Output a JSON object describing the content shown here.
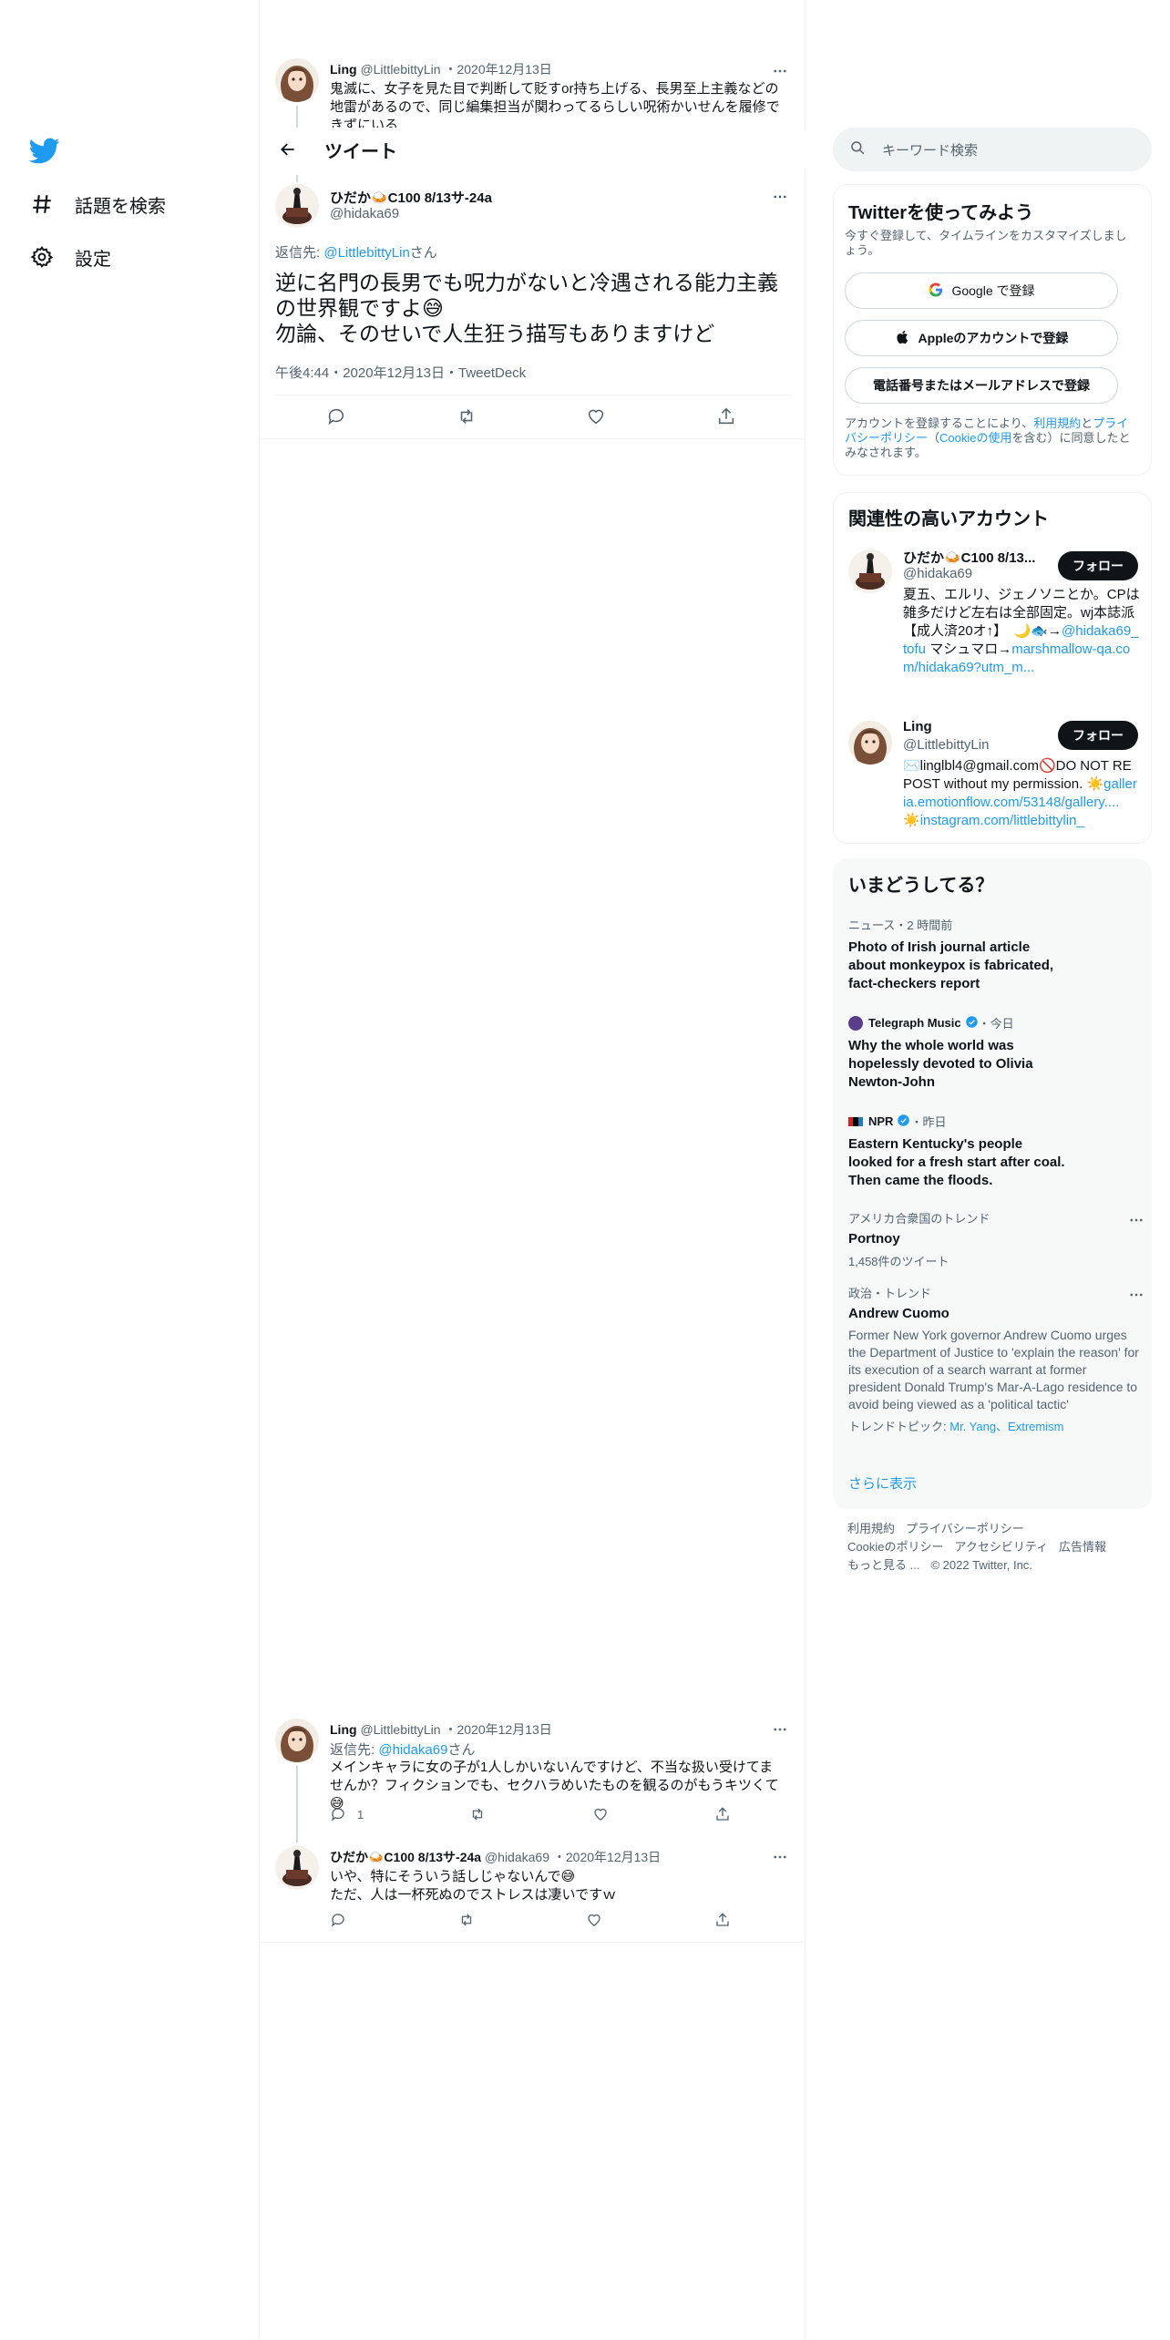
{
  "left_nav": {
    "explore_label": "話題を検索",
    "settings_label": "設定"
  },
  "header": {
    "title": "ツイート"
  },
  "parent_tweet": {
    "name": "Ling",
    "handle": "@LittlebittyLin",
    "date": "2020年12月13日",
    "text": "鬼滅に、女子を見た目で判断して貶すor持ち上げる、長男至上主義などの地雷があるので、同じ編集担当が関わってるらしい呪術かいせんを履修できずにいる"
  },
  "main_tweet": {
    "name": "ひだか🍛C100 8/13サ-24a",
    "handle": "@hidaka69",
    "reply_prefix": "返信先: ",
    "reply_to": "@LittlebittyLin",
    "reply_suffix": "さん",
    "line1": "逆に名門の長男でも呪力がないと冷遇される能力主義の世界観ですよ😅",
    "line2": "勿論、そのせいで人生狂う描写もありますけど",
    "time": "午後4:44",
    "date": "2020年12月13日",
    "source": "TweetDeck"
  },
  "reply1": {
    "name": "Ling",
    "handle": "@LittlebittyLin",
    "date": "2020年12月13日",
    "reply_prefix": "返信先: ",
    "reply_to": "@hidaka69",
    "reply_suffix": "さん",
    "text": "メインキャラに女の子が1人しかいないんですけど、不当な扱い受けてませんか？フィクションでも、セクハラめいたものを観るのがもうキツくて😅",
    "reply_count": "1"
  },
  "reply2": {
    "name": "ひだか🍛C100 8/13サ-24a",
    "handle": "@hidaka69",
    "date": "2020年12月13日",
    "line1": "いや、特にそういう話しじゃないんで😅",
    "line2": "ただ、人は一杯死ぬのでストレスは凄いですｗ"
  },
  "search": {
    "placeholder": "キーワード検索"
  },
  "signup": {
    "title": "Twitterを使ってみよう",
    "subtitle": "今すぐ登録して、タイムラインをカスタマイズしましょう。",
    "google": "Google で登録",
    "apple": "Appleのアカウントで登録",
    "phone": "電話番号またはメールアドレスで登録",
    "legal_1": "アカウントを登録することにより、",
    "legal_terms": "利用規約",
    "legal_2": "と",
    "legal_privacy": "プライバシーポリシー",
    "legal_3": "（",
    "legal_cookie": "Cookieの使用",
    "legal_4": "を含む）に同意したとみなされます。"
  },
  "related": {
    "title": "関連性の高いアカウント",
    "follow_label": "フォロー",
    "accounts": [
      {
        "name": "ひだか🍛C100 8/13...",
        "handle": "@hidaka69",
        "bio_1": "夏五、エルリ、ジェノソニとか。CPは雑多だけど左右は全部固定。wj本誌派【成人済20オ↑】　🌙🐟→",
        "bio_link1": "@hidaka69_tofu",
        "bio_2": " マシュマロ→",
        "bio_link2": "marshmallow-qa.com/hidaka69?utm_m..."
      },
      {
        "name": "Ling",
        "handle": "@LittlebittyLin",
        "bio_1": "✉️linglbl4@gmail.com🚫DO NOT REPOST without my permission. ☀️",
        "bio_link1": "galleria.emotionflow.com/53148/gallery....",
        "bio_2": " ☀️",
        "bio_link2": "instagram.com/littlebittylin_"
      }
    ]
  },
  "trends": {
    "title": "いまどうしてる？",
    "items": [
      {
        "ctx": "ニュース・2 時間前",
        "title": "Photo of Irish journal article about monkeypox is fabricated, fact-checkers report"
      },
      {
        "ctx_name": "Telegraph Music",
        "ctx_time": "・今日",
        "title": "Why the whole world was hopelessly devoted to Olivia Newton-John"
      },
      {
        "ctx_name": "NPR",
        "ctx_time": "・昨日",
        "title": "Eastern Kentucky's people looked for a fresh start after coal. Then came the floods."
      },
      {
        "ctx": "アメリカ合衆国のトレンド",
        "title": "Portnoy",
        "sub": "1,458件のツイート"
      },
      {
        "ctx": "政治・トレンド",
        "title": "Andrew Cuomo",
        "desc": "Former New York governor Andrew Cuomo urges the Department of Justice to 'explain the reason' for its execution of a search warrant at former president Donald Trump's Mar-A-Lago residence to avoid being viewed as a 'political tactic'",
        "topics_label": "トレンドトピック: ",
        "topics": "Mr. Yang、Extremism"
      }
    ],
    "show_more": "さらに表示"
  },
  "footer": {
    "terms": "利用規約",
    "privacy": "プライバシーポリシー",
    "cookie": "Cookieのポリシー",
    "accessibility": "アクセシビリティ",
    "ads": "広告情報",
    "more": "もっと見る ...",
    "copyright": "© 2022 Twitter, Inc."
  },
  "colors": {
    "accent": "#1d9bf0",
    "text": "#0f1419",
    "secondary": "#536471",
    "border": "#eff3f4"
  }
}
